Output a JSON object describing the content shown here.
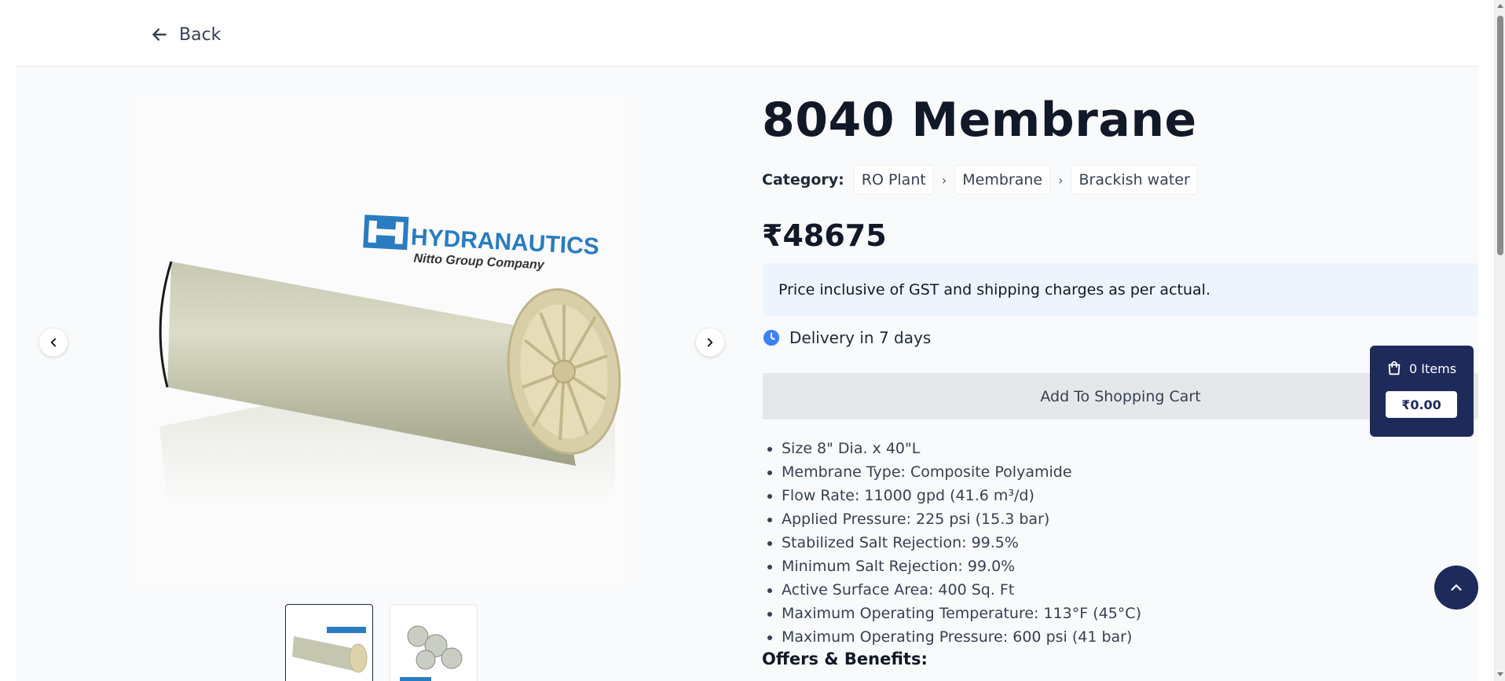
{
  "header": {
    "back_label": "Back"
  },
  "gallery": {
    "main_image": "hydranautics-8040-membrane",
    "main_image_logo_text": "HYDRANAUTICS",
    "main_image_logo_subtext": "Nitto Group Company",
    "thumbnails": [
      "membrane-thumbnail-1",
      "membrane-thumbnail-2"
    ],
    "active_thumbnail": 0
  },
  "product": {
    "title": "8040 Membrane",
    "category_label": "Category:",
    "categories": [
      "RO Plant",
      "Membrane",
      "Brackish water"
    ],
    "price": "₹48675",
    "price_note": "Price inclusive of GST and shipping charges as per actual.",
    "delivery": "Delivery in 7 days",
    "add_to_cart_label": "Add To Shopping Cart",
    "specs": [
      "Size 8\" Dia. x 40\"L",
      "Membrane Type: Composite Polyamide",
      "Flow Rate: 11000 gpd (41.6 m³/d)",
      "Applied Pressure: 225 psi (15.3 bar)",
      "Stabilized Salt Rejection: 99.5%",
      "Minimum Salt Rejection: 99.0%",
      "Active Surface Area: 400 Sq. Ft",
      "Maximum Operating Temperature: 113°F (45°C)",
      "Maximum Operating Pressure: 600 psi (41 bar)"
    ],
    "offers_heading": "Offers & Benefits:"
  },
  "cart": {
    "items_label": "0 Items",
    "total": "₹0.00"
  },
  "colors": {
    "accent": "#1e2a5a",
    "notice_bg": "#eef4fd",
    "delivery_icon": "#3b82f6",
    "button_bg": "#e5e7eb"
  }
}
